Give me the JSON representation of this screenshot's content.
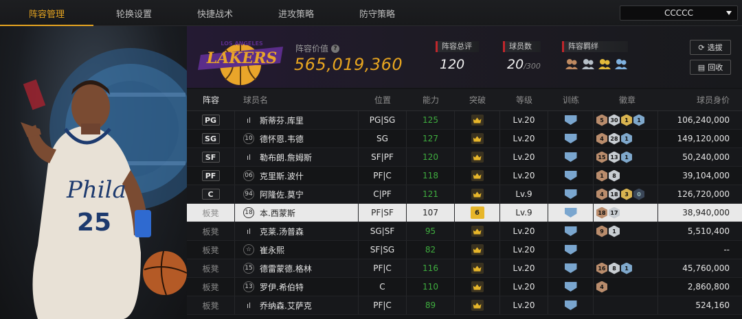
{
  "nav": {
    "tabs": [
      "阵容管理",
      "轮换设置",
      "快捷战术",
      "进攻策略",
      "防守策略"
    ],
    "active_tab": 0,
    "server": "CCCCC"
  },
  "header": {
    "value_label": "阵容价值",
    "value": "565,019,360",
    "team_logo_text": "LOS ANGELES LAKERS",
    "stats": {
      "rating_label": "阵容总评",
      "rating": "120",
      "players_label": "球员数",
      "players": "20",
      "players_max": "/300",
      "bond_label": "阵容羁绊"
    },
    "buttons": {
      "pick": "选拔",
      "recycle": "回收"
    }
  },
  "portrait": {
    "jersey_text": "Phila",
    "jersey_number": "25"
  },
  "table": {
    "columns": {
      "slot": "阵容",
      "name": "球员名",
      "pos": "位置",
      "ability": "能力",
      "breakthrough": "突破",
      "level": "等级",
      "training": "训练",
      "badges": "徽章",
      "value": "球员身价"
    },
    "rows": [
      {
        "slot": "PG",
        "boxed": true,
        "num": "ill",
        "name": "斯蒂芬.库里",
        "pos": "PG|SG",
        "ability": "125",
        "brk": "crown",
        "level": "Lv.20",
        "badges": [
          [
            "b",
            "5"
          ],
          [
            "s",
            "30"
          ],
          [
            "g",
            "1"
          ],
          [
            "d",
            "1"
          ]
        ],
        "value": "106,240,000"
      },
      {
        "slot": "SG",
        "boxed": true,
        "num": "10",
        "name": "德怀恩.韦德",
        "pos": "SG",
        "ability": "127",
        "brk": "crown",
        "level": "Lv.20",
        "badges": [
          [
            "b",
            "4"
          ],
          [
            "s",
            "28"
          ],
          [
            "d",
            "1"
          ]
        ],
        "value": "149,120,000"
      },
      {
        "slot": "SF",
        "boxed": true,
        "num": "ill",
        "name": "勒布朗.詹姆斯",
        "pos": "SF|PF",
        "ability": "120",
        "brk": "crown",
        "level": "Lv.20",
        "badges": [
          [
            "b",
            "15"
          ],
          [
            "s",
            "13"
          ],
          [
            "d",
            "1"
          ]
        ],
        "value": "50,240,000"
      },
      {
        "slot": "PF",
        "boxed": true,
        "num": "06",
        "name": "克里斯.波什",
        "pos": "PF|C",
        "ability": "118",
        "brk": "crown",
        "level": "Lv.20",
        "badges": [
          [
            "b",
            "1"
          ],
          [
            "s",
            "8"
          ]
        ],
        "value": "39,104,000"
      },
      {
        "slot": "C",
        "boxed": true,
        "num": "94",
        "name": "阿隆佐.莫宁",
        "pos": "C|PF",
        "ability": "121",
        "brk": "crown",
        "level": "Lv.9",
        "badges": [
          [
            "b",
            "4"
          ],
          [
            "s",
            "18"
          ],
          [
            "g",
            "3"
          ],
          [
            "k",
            "0"
          ]
        ],
        "value": "126,720,000"
      },
      {
        "slot": "板凳",
        "boxed": false,
        "num": "18",
        "name": "本.西蒙斯",
        "pos": "PF|SF",
        "ability": "107",
        "brk": "6",
        "level": "Lv.9",
        "badges": [
          [
            "b",
            "18"
          ],
          [
            "s",
            "17"
          ]
        ],
        "value": "38,940,000",
        "selected": true
      },
      {
        "slot": "板凳",
        "boxed": false,
        "num": "ill",
        "name": "克莱.汤普森",
        "pos": "SG|SF",
        "ability": "95",
        "brk": "crown",
        "level": "Lv.20",
        "badges": [
          [
            "b",
            "9"
          ],
          [
            "s",
            "1"
          ]
        ],
        "value": "5,510,400"
      },
      {
        "slot": "板凳",
        "boxed": false,
        "num": "star",
        "name": "崔永熙",
        "pos": "SF|SG",
        "ability": "82",
        "brk": "crown",
        "level": "Lv.20",
        "badges": [],
        "value": "--"
      },
      {
        "slot": "板凳",
        "boxed": false,
        "num": "15",
        "name": "德雷蒙德.格林",
        "pos": "PF|C",
        "ability": "116",
        "brk": "crown",
        "level": "Lv.20",
        "badges": [
          [
            "b",
            "16"
          ],
          [
            "s",
            "8"
          ],
          [
            "d",
            "1"
          ]
        ],
        "value": "45,760,000"
      },
      {
        "slot": "板凳",
        "boxed": false,
        "num": "13",
        "name": "罗伊.希伯特",
        "pos": "C",
        "ability": "110",
        "brk": "crown",
        "level": "Lv.20",
        "badges": [
          [
            "b",
            "4"
          ]
        ],
        "value": "2,860,800"
      },
      {
        "slot": "板凳",
        "boxed": false,
        "num": "ill",
        "name": "乔纳森.艾萨克",
        "pos": "PF|C",
        "ability": "89",
        "brk": "crown",
        "level": "Lv.20",
        "badges": [],
        "value": "524,160"
      }
    ]
  }
}
